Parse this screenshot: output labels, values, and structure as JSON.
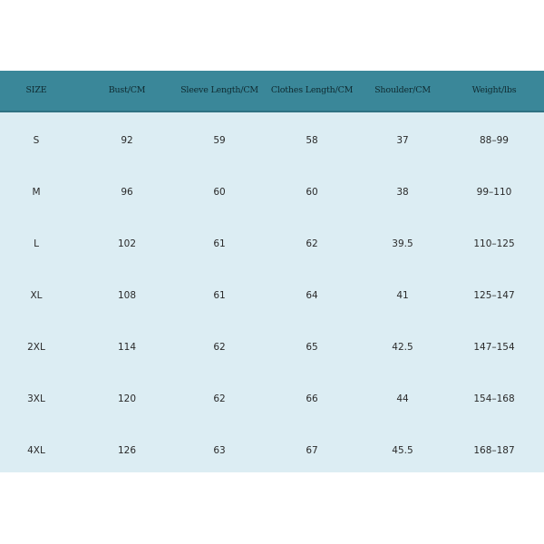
{
  "size_chart": {
    "headers": [
      "SIZE",
      "Bust/CM",
      "Sleeve Length/CM",
      "Clothes Length/CM",
      "Shoulder/CM",
      "Weight/lbs"
    ],
    "rows": [
      [
        "S",
        "92",
        "59",
        "58",
        "37",
        "88–99"
      ],
      [
        "M",
        "96",
        "60",
        "60",
        "38",
        "99–110"
      ],
      [
        "L",
        "102",
        "61",
        "62",
        "39.5",
        "110–125"
      ],
      [
        "XL",
        "108",
        "61",
        "64",
        "41",
        "125–147"
      ],
      [
        "2XL",
        "114",
        "62",
        "65",
        "42.5",
        "147–154"
      ],
      [
        "3XL",
        "120",
        "62",
        "66",
        "44",
        "154–168"
      ],
      [
        "4XL",
        "126",
        "63",
        "67",
        "45.5",
        "168–187"
      ]
    ]
  },
  "colors": {
    "header_bg": "#3a8799",
    "body_bg": "#dcedf3",
    "page_bg": "#ffffff"
  }
}
